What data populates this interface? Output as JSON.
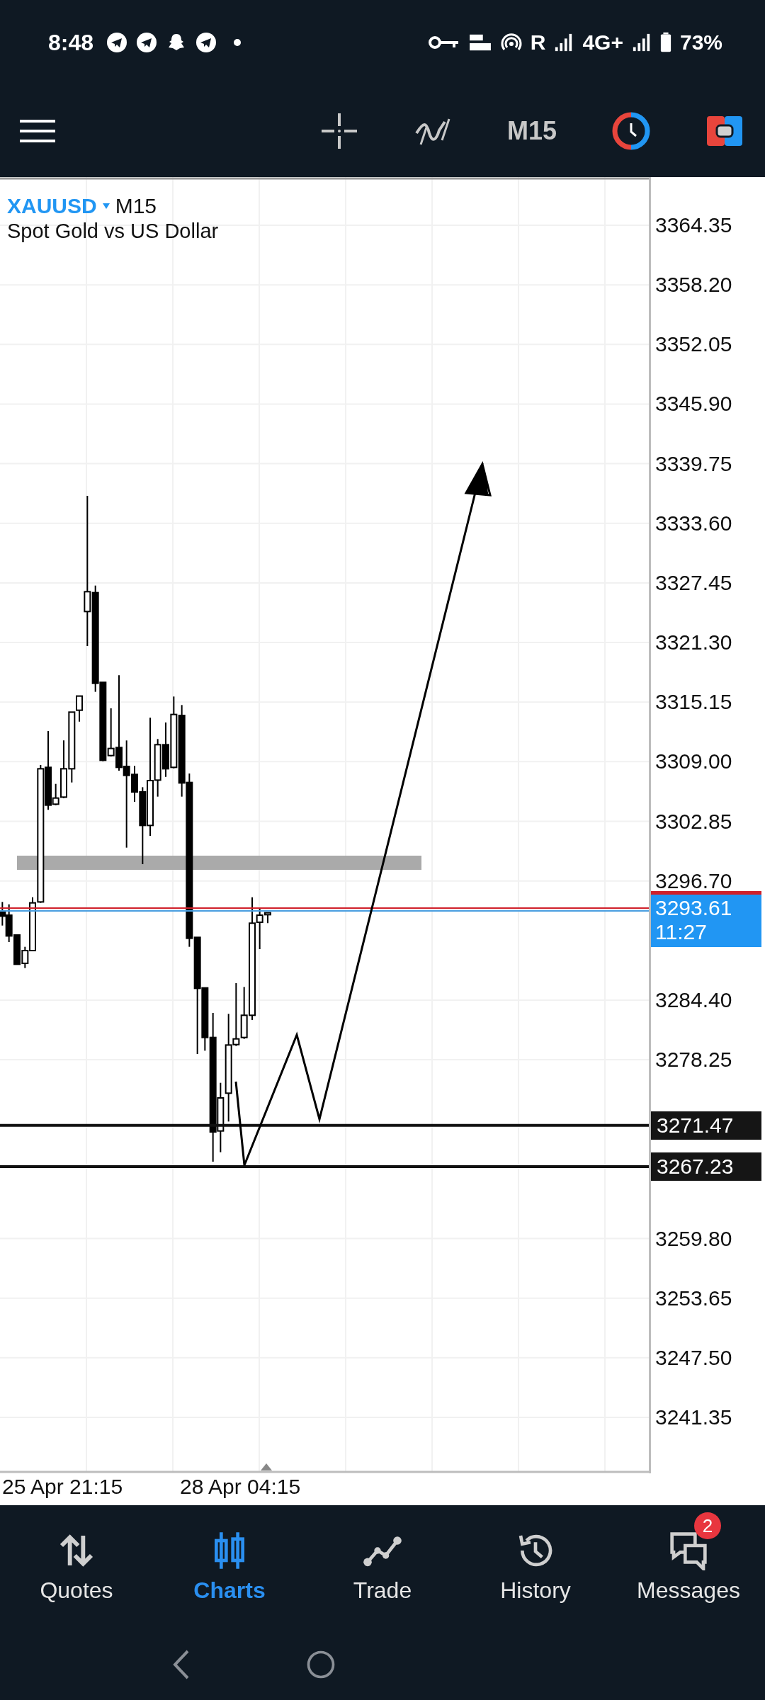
{
  "status_bar": {
    "time": "8:48",
    "roaming": "R",
    "network": "4G+",
    "battery": "73%"
  },
  "toolbar": {
    "timeframe": "M15"
  },
  "chart": {
    "symbol": "XAUUSD",
    "timeframe": "M15",
    "description": "Spot Gold vs US Dollar",
    "price_axis": [
      "3364.35",
      "3358.20",
      "3352.05",
      "3345.90",
      "3339.75",
      "3333.60",
      "3327.45",
      "3321.30",
      "3315.15",
      "3309.00",
      "3302.85",
      "3296.70",
      "3284.40",
      "3278.25",
      "3259.80",
      "3253.65",
      "3247.50",
      "3241.35"
    ],
    "current_price": {
      "price": "3293.61",
      "countdown": "11:27"
    },
    "levels": [
      {
        "price": "3271.47"
      },
      {
        "price": "3267.23"
      }
    ],
    "time_axis": [
      "25 Apr 21:15",
      "28 Apr 04:15"
    ]
  },
  "nav": [
    {
      "label": "Quotes",
      "selected": false
    },
    {
      "label": "Charts",
      "selected": true
    },
    {
      "label": "Trade",
      "selected": false
    },
    {
      "label": "History",
      "selected": false
    },
    {
      "label": "Messages",
      "selected": false,
      "badge": "2"
    }
  ]
}
